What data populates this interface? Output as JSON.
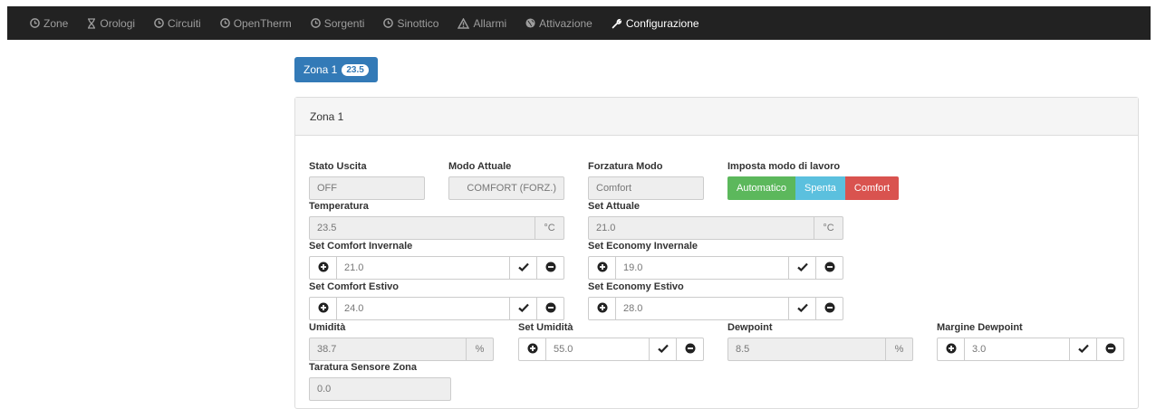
{
  "nav": {
    "items": [
      {
        "label": "Zone",
        "icon": "clock-circle-icon"
      },
      {
        "label": "Orologi",
        "icon": "hourglass-icon"
      },
      {
        "label": "Circuiti",
        "icon": "clock-circle-icon"
      },
      {
        "label": "OpenTherm",
        "icon": "clock-circle-icon"
      },
      {
        "label": "Sorgenti",
        "icon": "clock-circle-icon"
      },
      {
        "label": "Sinottico",
        "icon": "clock-circle-icon"
      },
      {
        "label": "Allarmi",
        "icon": "warning-icon"
      },
      {
        "label": "Attivazione",
        "icon": "globe-icon"
      },
      {
        "label": "Configurazione",
        "icon": "wrench-icon"
      }
    ]
  },
  "tab": {
    "label": "Zona 1",
    "badge": "23.5"
  },
  "panel": {
    "title": "Zona 1",
    "stato_uscita": {
      "label": "Stato Uscita",
      "value": "OFF"
    },
    "modo_attuale": {
      "label": "Modo Attuale",
      "value": "COMFORT (FORZ.)"
    },
    "forzatura_modo": {
      "label": "Forzatura Modo",
      "value": "Comfort"
    },
    "imposta_modo": {
      "label": "Imposta modo di lavoro",
      "buttons": [
        "Automatico",
        "Spenta",
        "Comfort"
      ]
    },
    "temperatura": {
      "label": "Temperatura",
      "value": "23.5",
      "unit": "°C"
    },
    "set_attuale": {
      "label": "Set Attuale",
      "value": "21.0",
      "unit": "°C"
    },
    "set_comfort_invernale": {
      "label": "Set Comfort Invernale",
      "value": "21.0"
    },
    "set_economy_invernale": {
      "label": "Set Economy Invernale",
      "value": "19.0"
    },
    "set_comfort_estivo": {
      "label": "Set Comfort Estivo",
      "value": "24.0"
    },
    "set_economy_estivo": {
      "label": "Set Economy Estivo",
      "value": "28.0"
    },
    "umidita": {
      "label": "Umidità",
      "value": "38.7",
      "unit": "%"
    },
    "set_umidita": {
      "label": "Set Umidità",
      "value": "55.0"
    },
    "dewpoint": {
      "label": "Dewpoint",
      "value": "8.5",
      "unit": "%"
    },
    "margine_dewpoint": {
      "label": "Margine Dewpoint",
      "value": "3.0"
    },
    "taratura": {
      "label": "Taratura Sensore Zona",
      "value": "0.0"
    }
  },
  "colors": {
    "navbar": "#222222",
    "primary": "#337ab7",
    "success": "#5cb85c",
    "info": "#5bc0de",
    "danger": "#d9534f"
  }
}
